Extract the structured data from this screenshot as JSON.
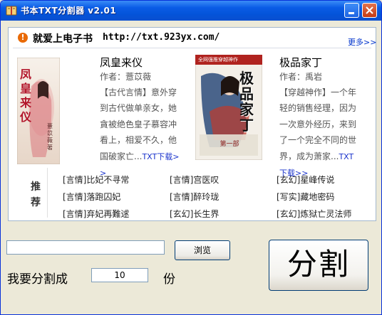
{
  "window": {
    "title": "书本TXT分割器 v2.01"
  },
  "header": {
    "site_title": "就爱上电子书",
    "site_url": "http://txt.923yx.com/",
    "more_label": "更多>>"
  },
  "books": [
    {
      "title": "凤皇来仪",
      "author": "作者：薏苡薇",
      "description": "【古代言情】意外穿到古代做单亲女，她貪被绝色皇子慕容冲看上，相爱不久，他国破家亡...",
      "download_label": "TXT下载>>",
      "cover_text": "凤皇来仪",
      "cover_author": "薏苡薇 著"
    },
    {
      "title": "极品家丁",
      "author": "作者：禹岩",
      "description": "【穿越神作】一个年轻的销售经理，因为一次意外经历，来到了一个完全不同的世界，成为萧家...",
      "download_label": "TXT下载>>",
      "cover_text": "极品家丁",
      "cover_top": "全网强推穿越神作",
      "cover_bottom": "第一部"
    }
  ],
  "recommend": {
    "label": "推荐",
    "columns": [
      [
        "[言情]比妃不寻常",
        "[言情]落跑囚妃",
        "[言情]弃妃再難逑"
      ],
      [
        "[言情]宫医叹",
        "[言情]醉玲珑",
        "[玄幻]长生界"
      ],
      [
        "[玄幻]星峰传说",
        "[写实]藏地密码",
        "[玄幻]炼狱亡灵法师"
      ]
    ]
  },
  "controls": {
    "file_path": "",
    "browse_label": "浏览",
    "split_label": "我要分割成",
    "count_value": "10",
    "unit_label": "份",
    "split_button_label": "分割"
  }
}
